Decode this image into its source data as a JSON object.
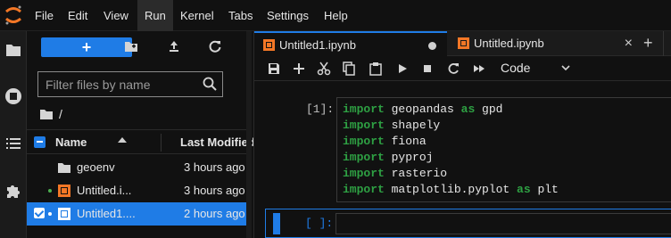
{
  "menubar": {
    "logo_icon": "jupyter-logo-icon",
    "items": [
      "File",
      "Edit",
      "View",
      "Run",
      "Kernel",
      "Tabs",
      "Settings",
      "Help"
    ],
    "active": "Run"
  },
  "activity_bar": {
    "icons": [
      "folder-icon",
      "running-stop-icon",
      "list-icon",
      "puzzle-icon"
    ]
  },
  "file_browser": {
    "new_button_label": "+",
    "toolbar_icons": [
      "new-folder-icon",
      "upload-icon",
      "refresh-icon"
    ],
    "search": {
      "placeholder": "Filter files by name",
      "value": ""
    },
    "breadcrumb": "/",
    "header": {
      "name": "Name",
      "last_modified": "Last Modified"
    },
    "rows": [
      {
        "name": "geoenv",
        "modified": "3 hours ago",
        "type": "folder",
        "selected": false,
        "running": false
      },
      {
        "name": "Untitled.i...",
        "modified": "3 hours ago",
        "type": "notebook",
        "selected": false,
        "running": true
      },
      {
        "name": "Untitled1....",
        "modified": "2 hours ago",
        "type": "notebook",
        "selected": true,
        "running": true
      }
    ]
  },
  "tabs": [
    {
      "label": "Untitled1.ipynb",
      "active": true,
      "status": "unsaved-dot"
    },
    {
      "label": "Untitled.ipynb",
      "active": false,
      "status": "close"
    }
  ],
  "tab_add_label": "+",
  "tab_close_label": "×",
  "notebook_toolbar": {
    "icons": [
      "save-icon",
      "add-cell-icon",
      "cut-icon",
      "copy-icon",
      "paste-icon",
      "run-icon",
      "stop-icon",
      "restart-icon",
      "fast-forward-icon"
    ],
    "cell_type": "Code"
  },
  "cells": [
    {
      "prompt": "[1]:",
      "lines": [
        {
          "kw": "import",
          "rest": " geopandas ",
          "kw2": "as",
          "rest2": " gpd"
        },
        {
          "kw": "import",
          "rest": " shapely",
          "kw2": "",
          "rest2": ""
        },
        {
          "kw": "import",
          "rest": " fiona",
          "kw2": "",
          "rest2": ""
        },
        {
          "kw": "import",
          "rest": " pyproj",
          "kw2": "",
          "rest2": ""
        },
        {
          "kw": "import",
          "rest": " rasterio",
          "kw2": "",
          "rest2": ""
        },
        {
          "kw": "import",
          "rest": " matplotlib.pyplot ",
          "kw2": "as",
          "rest2": " plt"
        }
      ]
    },
    {
      "prompt": "[ ]:",
      "lines": []
    }
  ],
  "colors": {
    "accent": "#1f7ce6",
    "keyword": "#2ea043",
    "notebook_icon": "#f37726",
    "background": "#111111"
  }
}
